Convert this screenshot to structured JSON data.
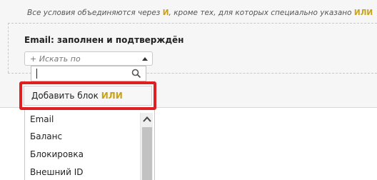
{
  "hint": {
    "prefix": "Все условия объединяются через",
    "and_kw": "И",
    "middle": ", кроме тех, для которых специально указано",
    "or_kw": "ИЛИ"
  },
  "condition": {
    "label": "Email: заполнен и подтверждён"
  },
  "select": {
    "placeholder": "+ Искать по"
  },
  "search": {
    "value": ""
  },
  "add_block": {
    "label": "Добавить блок",
    "kw": "ИЛИ"
  },
  "options": [
    "Email",
    "Баланс",
    "Блокировка",
    "Внешний ID"
  ],
  "colors": {
    "accent_keyword": "#c9a21a",
    "highlight_border": "#e02020",
    "panel_bg": "#f6f6f6"
  }
}
